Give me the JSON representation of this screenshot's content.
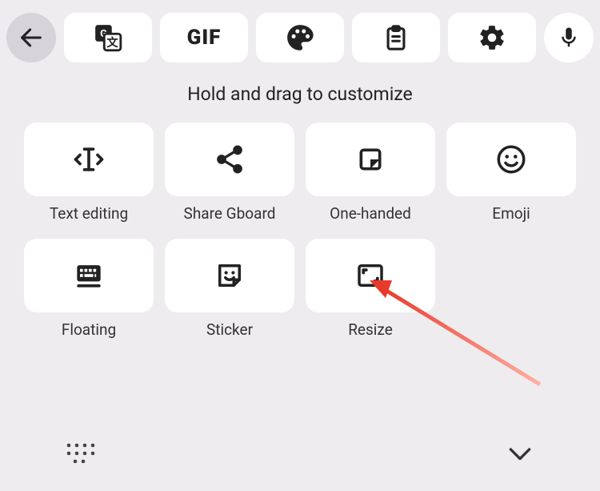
{
  "topbar": {
    "translate_label": "Translate",
    "gif_label": "GIF",
    "theme_label": "Theme",
    "clipboard_label": "Clipboard",
    "settings_label": "Settings"
  },
  "instruction": "Hold and drag to customize",
  "tiles": {
    "text_editing": "Text editing",
    "share_gboard": "Share Gboard",
    "one_handed": "One-handed",
    "emoji": "Emoji",
    "floating": "Floating",
    "sticker": "Sticker",
    "resize": "Resize"
  }
}
